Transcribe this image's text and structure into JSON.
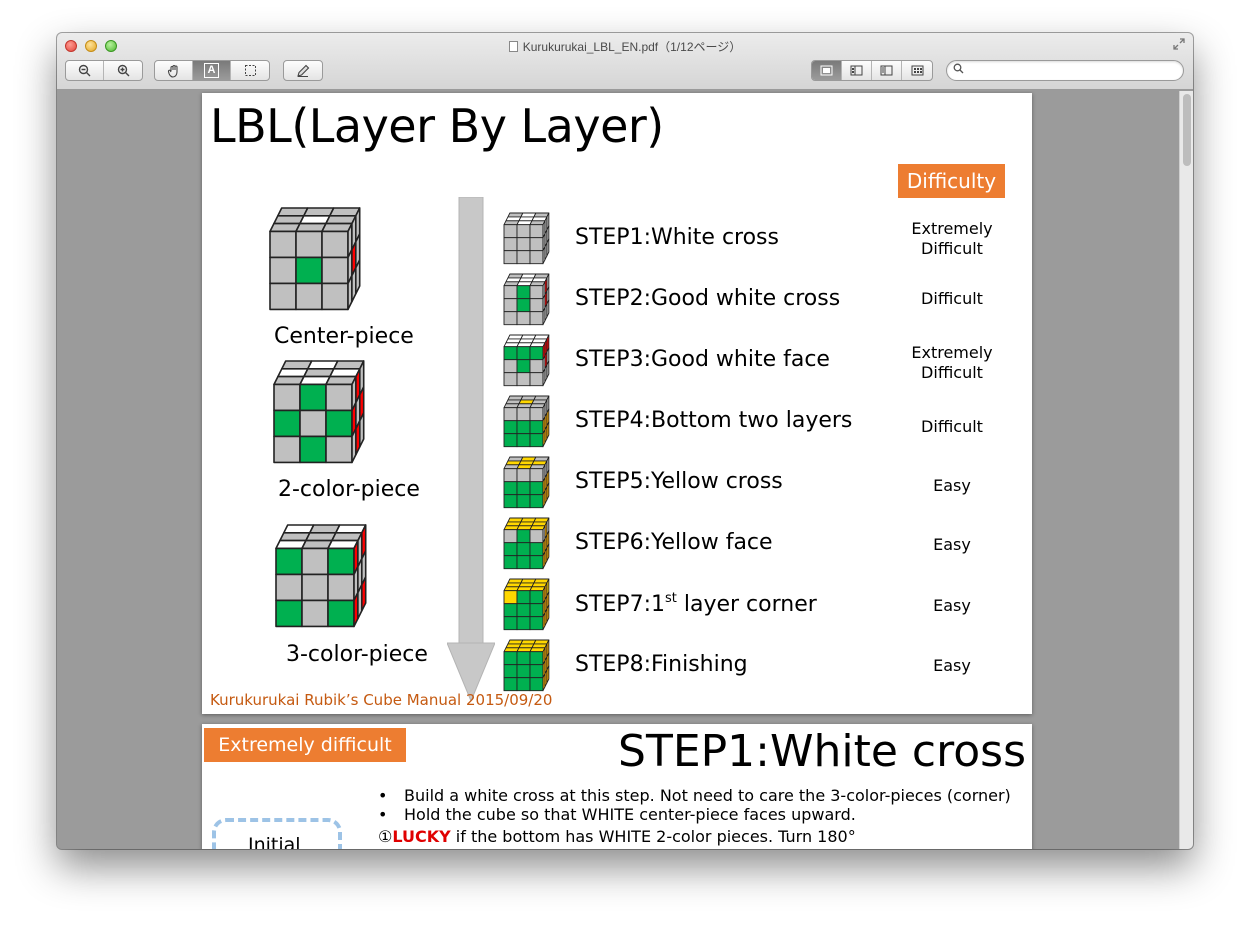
{
  "window": {
    "title": "Kurukurukai_LBL_EN.pdf（1/12ページ）"
  },
  "toolbar": {
    "zoom_out_icon": "zoom-out-icon",
    "zoom_in_icon": "zoom-in-icon",
    "hand_tool_icon": "hand-icon",
    "text_tool_label": "A",
    "select_tool_icon": "selection-icon",
    "annotate_icon": "pencil-icon",
    "view_modes": [
      "content-only",
      "thumbnails",
      "table-of-contents",
      "contact-sheet"
    ],
    "search_placeholder": ""
  },
  "page1": {
    "title": "LBL(Layer By Layer)",
    "difficulty_header": "Difficulty",
    "pieces": [
      {
        "label": "Center-piece"
      },
      {
        "label": "2-color-piece"
      },
      {
        "label": "3-color-piece"
      }
    ],
    "steps": [
      {
        "label": "STEP1:White cross",
        "difficulty": [
          "Extremely",
          "Difficult"
        ]
      },
      {
        "label": "STEP2:Good white cross",
        "difficulty": [
          "Difficult"
        ]
      },
      {
        "label": "STEP3:Good white face",
        "difficulty": [
          "Extremely",
          "Difficult"
        ]
      },
      {
        "label": "STEP4:Bottom two layers",
        "difficulty": [
          "Difficult"
        ]
      },
      {
        "label": "STEP5:Yellow cross",
        "difficulty": [
          "Easy"
        ]
      },
      {
        "label": "STEP6:Yellow face",
        "difficulty": [
          "Easy"
        ]
      },
      {
        "label_prefix": "STEP7:1",
        "label_sup": "st",
        "label_suffix": " layer corner",
        "difficulty": [
          "Easy"
        ]
      },
      {
        "label": "STEP8:Finishing",
        "difficulty": [
          "Easy"
        ]
      }
    ],
    "footer": "Kurukurukai Rubik’s Cube Manual 2015/09/20"
  },
  "page2": {
    "badge": "Extremely difficult",
    "title": "STEP1:White cross",
    "bullets": [
      "Build a white cross at this step.   Not need to care the 3-color-pieces (corner)",
      "Hold the cube so that WHITE center-piece faces upward."
    ],
    "lucky_prefix": "①",
    "lucky_word": "LUCKY",
    "lucky_rest": " if the bottom has WHITE 2-color pieces.  Turn 180°",
    "initial_label": "Initial"
  },
  "colors": {
    "accent_orange": "#ed7d31",
    "footer_orange": "#c55a11",
    "cube_gray": "#c0c0c0",
    "cube_white": "#ffffff",
    "cube_green": "#00b050",
    "cube_red": "#ff0000",
    "cube_yellow": "#ffd700",
    "cube_orange": "#ffb000"
  }
}
